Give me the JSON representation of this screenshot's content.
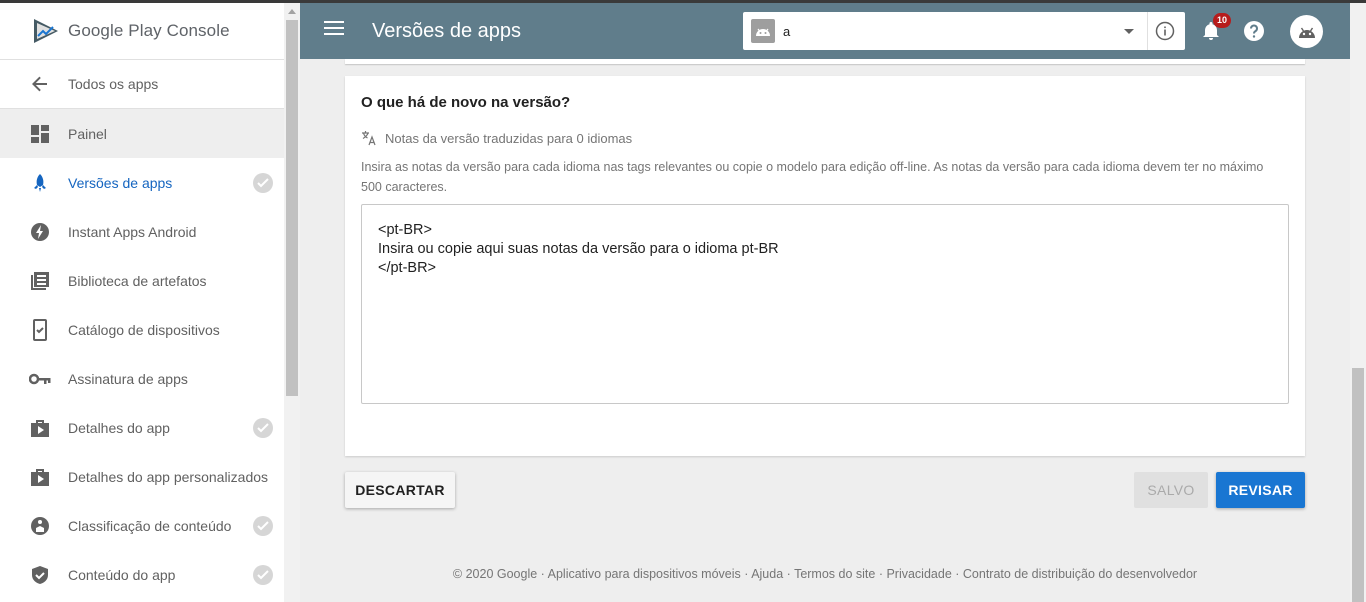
{
  "brand": {
    "google": "Google",
    "play": "Play",
    "console": "Console"
  },
  "sidebar": {
    "back_label": "Todos os apps",
    "items": [
      {
        "label": "Painel",
        "icon": "dashboard-icon",
        "checked": false
      },
      {
        "label": "Versões de apps",
        "icon": "rocket-icon",
        "checked": true,
        "active": true
      },
      {
        "label": "Instant Apps Android",
        "icon": "bolt-icon",
        "checked": false
      },
      {
        "label": "Biblioteca de artefatos",
        "icon": "library-icon",
        "checked": false
      },
      {
        "label": "Catálogo de dispositivos",
        "icon": "device-check-icon",
        "checked": false
      },
      {
        "label": "Assinatura de apps",
        "icon": "key-icon",
        "checked": false
      },
      {
        "label": "Detalhes do app",
        "icon": "store-icon",
        "checked": true
      },
      {
        "label": "Detalhes do app personalizados",
        "icon": "store-icon",
        "checked": false
      },
      {
        "label": "Classificação de conteúdo",
        "icon": "rating-icon",
        "checked": true
      },
      {
        "label": "Conteúdo do app",
        "icon": "shield-icon",
        "checked": true
      }
    ]
  },
  "header": {
    "title": "Versões de apps",
    "app_selector_value": "a",
    "notifications_count": "10",
    "color": "#607d8b"
  },
  "card": {
    "title": "O que há de novo na versão?",
    "translated_text": "Notas da versão traduzidas para 0 idiomas",
    "help_text": "Insira as notas da versão para cada idioma nas tags relevantes ou copie o modelo para edição off-line. As notas da versão para cada idioma devem ter no máximo 500 caracteres.",
    "notes_value": "<pt-BR>\nInsira ou copie aqui suas notas da versão para o idioma pt-BR\n</pt-BR>"
  },
  "actions": {
    "discard": "DESCARTAR",
    "saved": "SALVO",
    "review": "REVISAR"
  },
  "footer": {
    "copyright": "© 2020 Google",
    "links": [
      "Aplicativo para dispositivos móveis",
      "Ajuda",
      "Termos do site",
      "Privacidade",
      "Contrato de distribuição do desenvolvedor"
    ],
    "separator": " · "
  },
  "colors": {
    "accent": "#1976d2",
    "active_nav": "#1565c0"
  }
}
